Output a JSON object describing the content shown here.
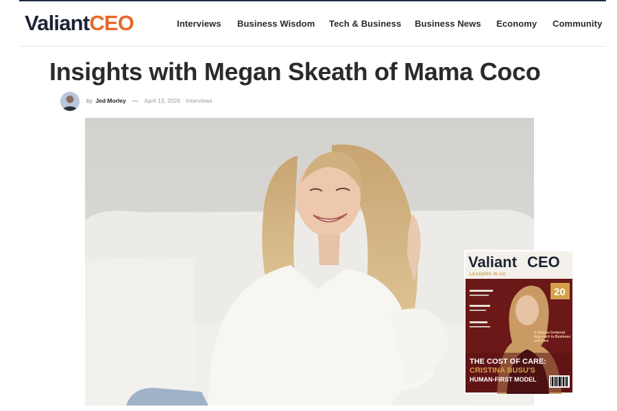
{
  "header": {
    "logo_part1": "Valiant",
    "logo_part2": "CEO",
    "nav": [
      "Interviews",
      "Business Wisdom",
      "Tech & Business",
      "Business News",
      "Economy",
      "Community"
    ]
  },
  "article": {
    "title": "Insights with Megan Skeath of Mama Coco",
    "byline_prefix": "by",
    "author": "Jed Morley",
    "separator": "—",
    "date": "April 13, 2026",
    "category": "Interviews"
  },
  "magazine": {
    "brand_part1": "Valiant",
    "brand_part2": "CEO",
    "tagline": "LEADERS IN AC",
    "badge": "20",
    "feature_blurb": "A Human-Centered Approach to Business and Care",
    "headline_line1": "THE COST OF CARE:",
    "headline_line2": "CRISTINA BUSU'S",
    "headline_line3": "HUMAN-FIRST MODEL"
  },
  "colors": {
    "brand_dark": "#1c2434",
    "brand_orange": "#e8682a",
    "magazine_bg": "#6b1818",
    "magazine_gold": "#d4a04a"
  }
}
